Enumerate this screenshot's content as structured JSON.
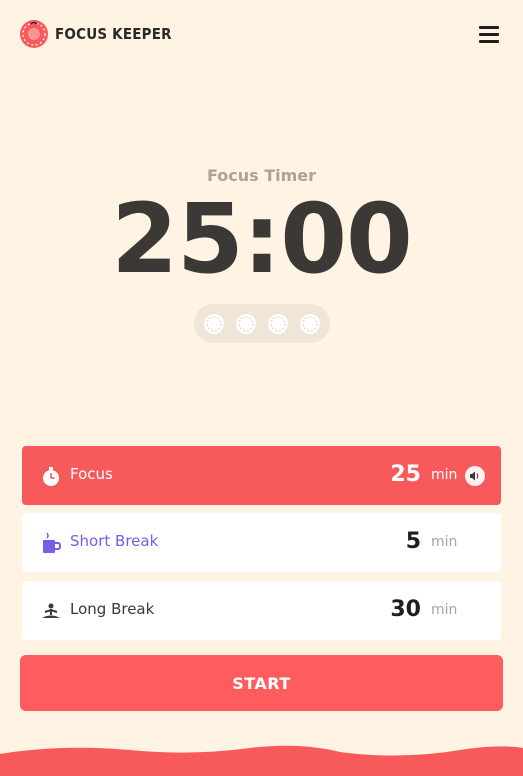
{
  "header": {
    "logo_text": "FOCUS KEEPER",
    "logo_icon": "tomato-icon",
    "menu_icon": "hamburger-menu-icon"
  },
  "timer": {
    "label": "Focus Timer",
    "value": "25:00",
    "sessions_total": 4,
    "sessions_completed": 0
  },
  "settings": {
    "rows": [
      {
        "label": "Focus",
        "value": "25",
        "unit": "min",
        "icon": "stopwatch-icon",
        "active": true,
        "sound_icon": "speaker-icon"
      },
      {
        "label": "Short Break",
        "value": "5",
        "unit": "min",
        "icon": "coffee-mug-icon",
        "active": false
      },
      {
        "label": "Long Break",
        "value": "30",
        "unit": "min",
        "icon": "meditation-icon",
        "active": false
      }
    ]
  },
  "start": {
    "label": "START"
  },
  "colors": {
    "background": "#fff3e3",
    "accent": "#f85a5b",
    "start_button": "#fe5c5f",
    "short_break": "#7a5ce8",
    "timer_text": "#3b3835"
  }
}
